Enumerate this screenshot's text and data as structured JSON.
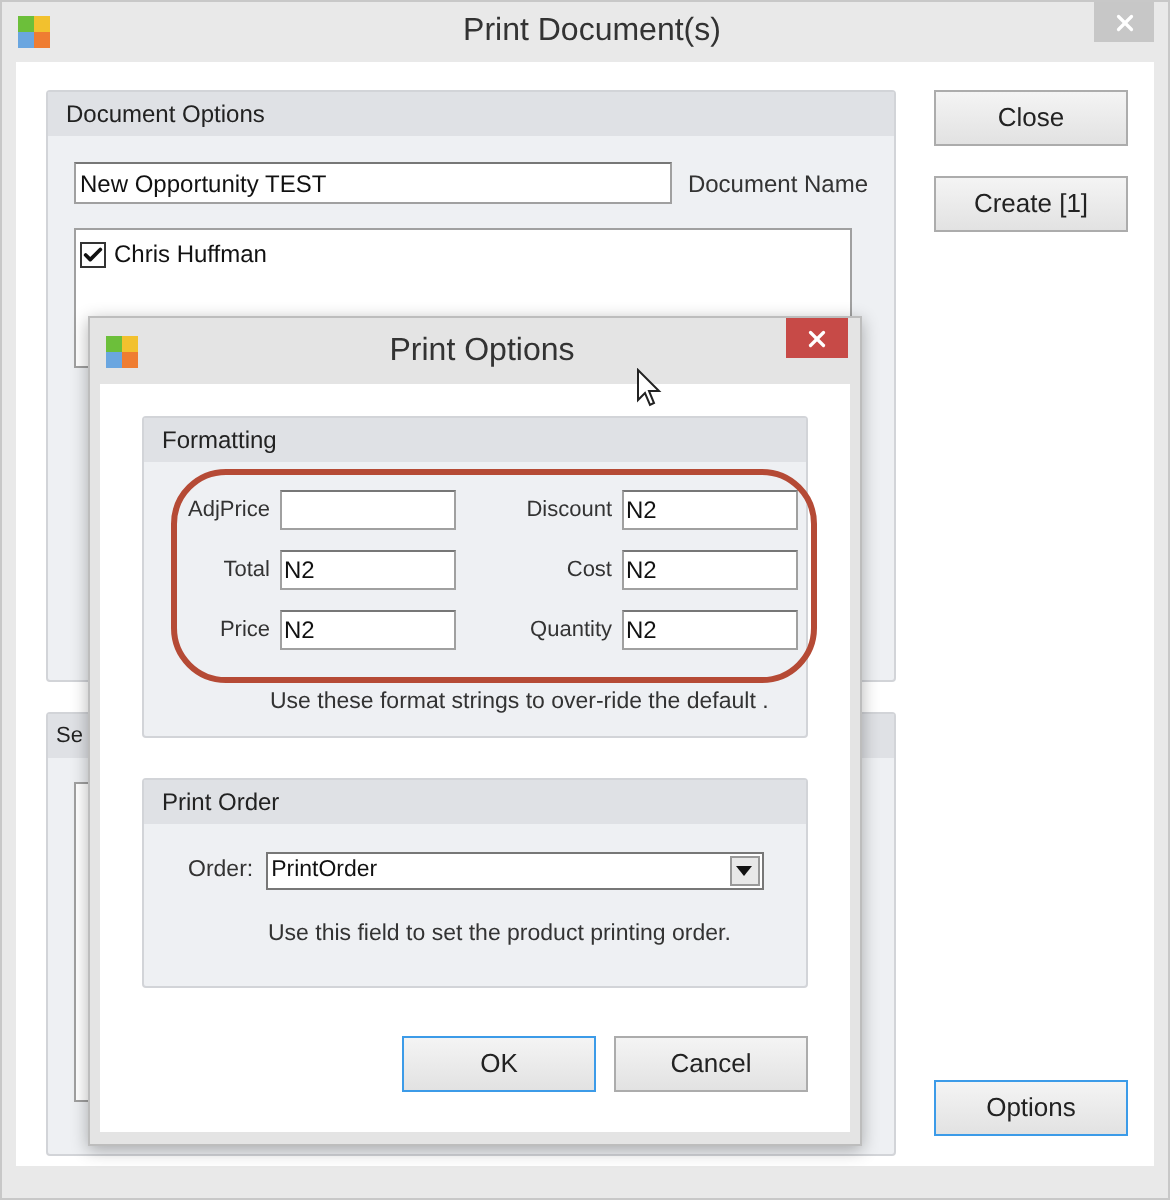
{
  "main_window": {
    "title": "Print Document(s)",
    "document_options": {
      "title": "Document Options",
      "document_name": {
        "value": "New Opportunity TEST",
        "label": "Document Name"
      },
      "recipients": [
        {
          "name": "Chris Huffman",
          "checked": true
        }
      ]
    },
    "second_group": {
      "title": "Se"
    },
    "buttons": [
      {
        "label": "Close",
        "focused": false
      },
      {
        "label": "Create [1]",
        "focused": false
      }
    ],
    "options_button": {
      "label": "Options",
      "focused": true
    }
  },
  "dialog": {
    "title": "Print Options",
    "formatting": {
      "title": "Formatting",
      "fields": [
        {
          "label": "AdjPrice"
        },
        {
          "label": "Discount",
          "value": "N2"
        },
        {
          "label": "Total",
          "value": "N2"
        },
        {
          "label": "Cost",
          "value": "N2"
        },
        {
          "label": "Price",
          "value": "N2"
        },
        {
          "label": "Quantity",
          "value": "N2"
        }
      ],
      "hint": "Use these format strings to over-ride the default ."
    },
    "print_order": {
      "title": "Print Order",
      "label": "Order:",
      "value": "PrintOrder",
      "hint": "Use this field to set the product printing order."
    },
    "buttons": [
      {
        "label": "OK",
        "focused": true
      },
      {
        "label": "Cancel",
        "focused": false
      }
    ]
  }
}
